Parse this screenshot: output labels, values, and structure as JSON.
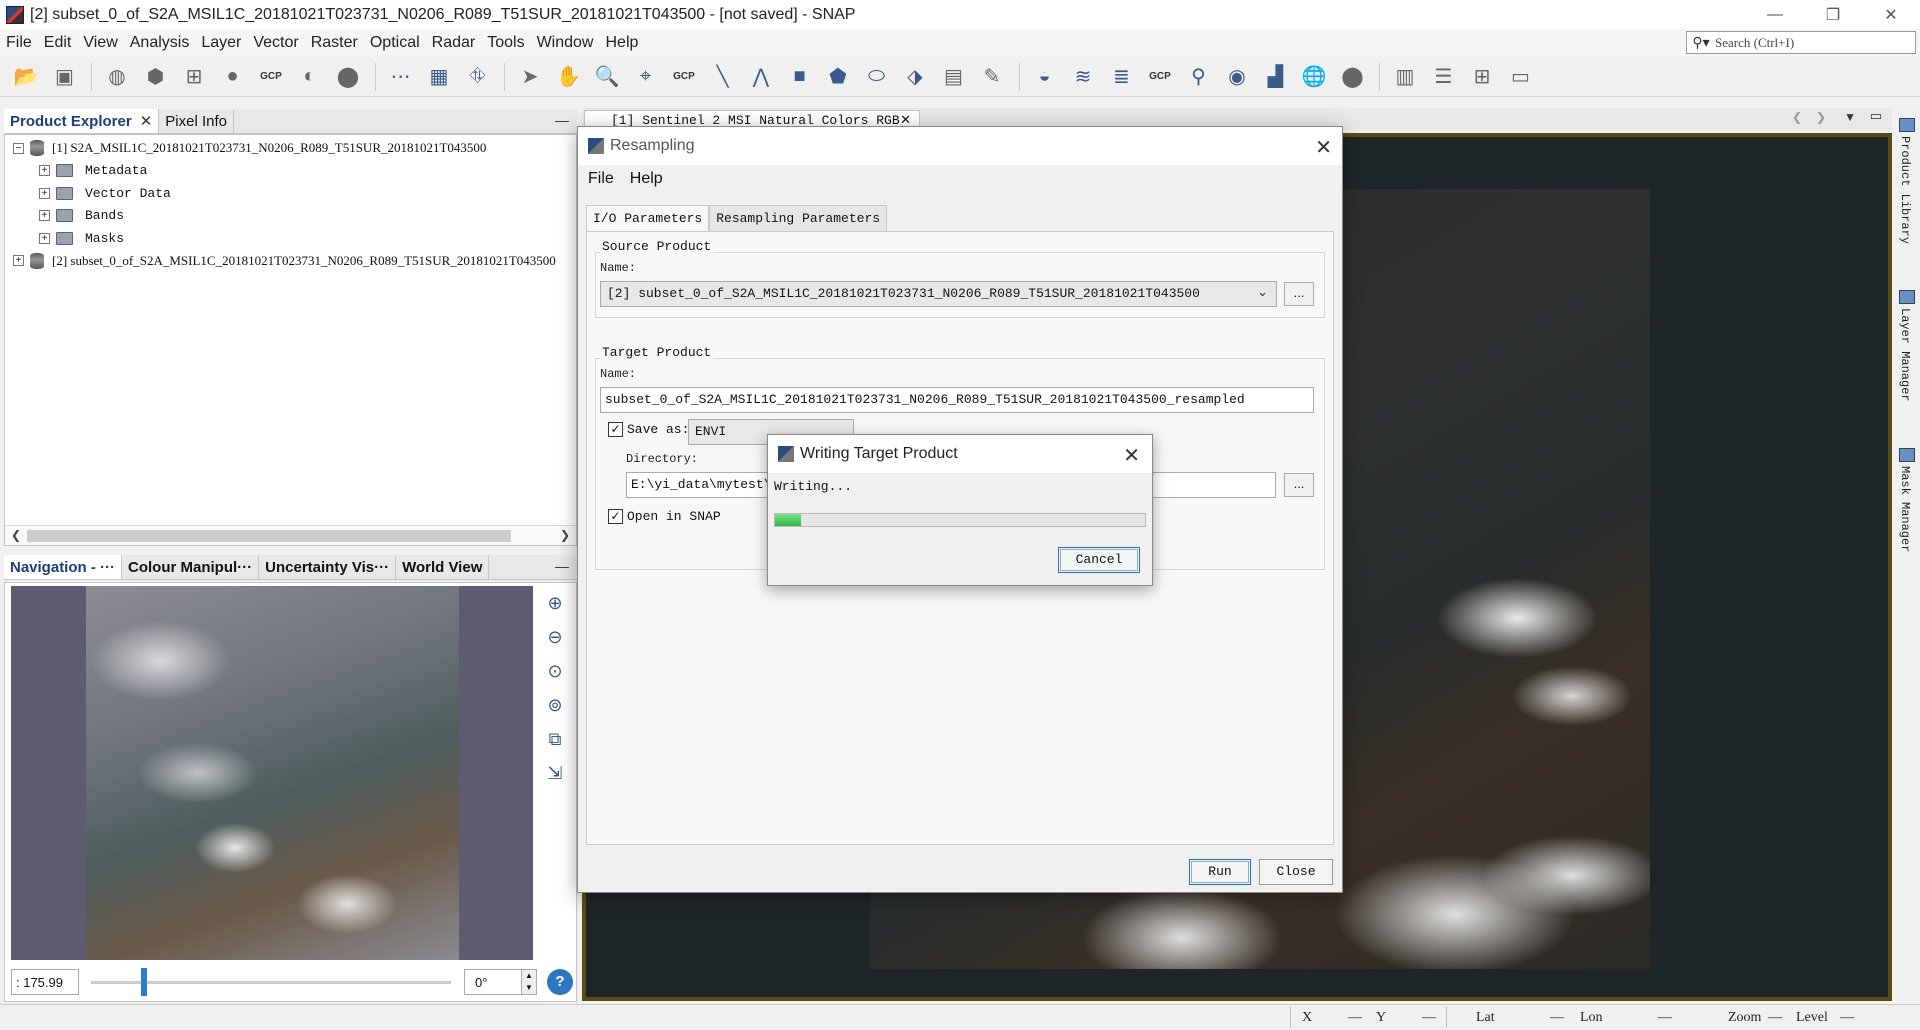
{
  "window": {
    "title": "[2] subset_0_of_S2A_MSIL1C_20181021T023731_N0206_R089_T51SUR_20181021T043500 - [not saved] - SNAP"
  },
  "menu": [
    "File",
    "Edit",
    "View",
    "Analysis",
    "Layer",
    "Vector",
    "Raster",
    "Optical",
    "Radar",
    "Tools",
    "Window",
    "Help"
  ],
  "search": {
    "placeholder": "Search (Ctrl+I)"
  },
  "toolbar": {
    "gcp_label": "GCP"
  },
  "explorer": {
    "tabs": [
      "Product Explorer",
      "Pixel Info"
    ],
    "tree": [
      {
        "label": "[1]  S2A_MSIL1C_20181021T023731_N0206_R089_T51SUR_20181021T043500",
        "level": 0,
        "expander": "−"
      },
      {
        "label": "Metadata",
        "level": 1,
        "expander": "+"
      },
      {
        "label": "Vector Data",
        "level": 1,
        "expander": "+"
      },
      {
        "label": "Bands",
        "level": 1,
        "expander": "+"
      },
      {
        "label": "Masks",
        "level": 1,
        "expander": "+"
      },
      {
        "label": "[2]  subset_0_of_S2A_MSIL1C_20181021T023731_N0206_R089_T51SUR_20181021T043500",
        "level": 0,
        "expander": "+"
      }
    ]
  },
  "navigation": {
    "tabs": [
      "Navigation - ···",
      "Colour Manipul···",
      "Uncertainty Vis···",
      "World View"
    ],
    "zoom_value": ": 175.99",
    "angle_value": "0°",
    "slider_position": 0.14
  },
  "image_view": {
    "tab_label": "[1] Sentinel 2 MSI Natural Colors RGB"
  },
  "right_rail": [
    "Product Library",
    "Layer Manager",
    "Mask Manager"
  ],
  "resampling_dialog": {
    "title": "Resampling",
    "menu": [
      "File",
      "Help"
    ],
    "tabs": [
      "I/O Parameters",
      "Resampling Parameters"
    ],
    "source_group": "Source Product",
    "source_name_label": "Name:",
    "source_value": "[2]  subset_0_of_S2A_MSIL1C_20181021T023731_N0206_R089_T51SUR_20181021T043500",
    "target_group": "Target Product",
    "target_name_label": "Name:",
    "target_value": "subset_0_of_S2A_MSIL1C_20181021T023731_N0206_R089_T51SUR_20181021T043500_resampled",
    "save_as_label": "Save as:",
    "save_as_value": "ENVI",
    "save_as_checked": true,
    "directory_label": "Directory:",
    "directory_value": "E:\\yi_data\\mytest\\",
    "open_in_snap_label": "Open in SNAP",
    "open_in_snap_checked": true,
    "browse_label": "...",
    "run_label": "Run",
    "close_label": "Close"
  },
  "writing_dialog": {
    "title": "Writing Target Product",
    "message": "Writing...",
    "progress": 0.07,
    "cancel_label": "Cancel"
  },
  "statusbar": {
    "x": "X",
    "y": "Y",
    "lat": "Lat",
    "lon": "Lon",
    "zoom": "Zoom",
    "level": "Level",
    "dash": "—"
  },
  "colors": {
    "accent": "#2a7cd6",
    "progress_fill": "#2fb64a",
    "frame": "#5c4a14"
  }
}
